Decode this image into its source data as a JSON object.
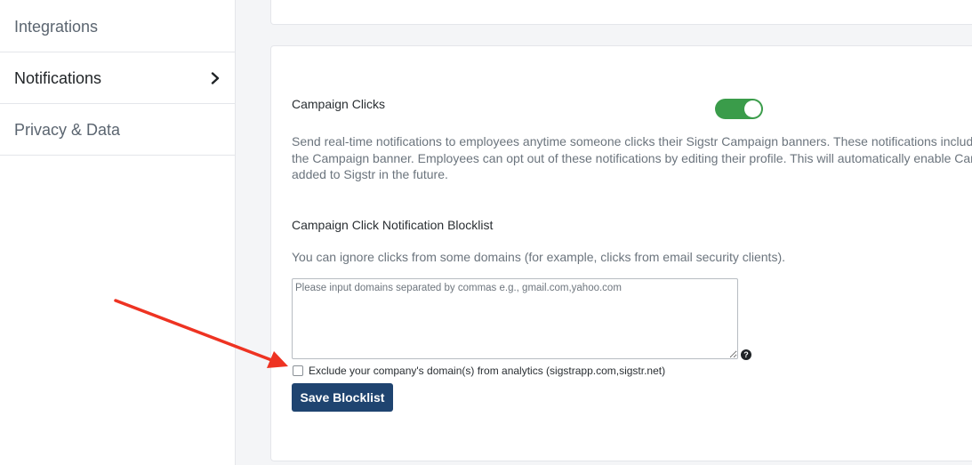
{
  "sidebar": {
    "items": [
      {
        "label": "Integrations",
        "active": false
      },
      {
        "label": "Notifications",
        "active": true
      },
      {
        "label": "Privacy & Data",
        "active": false
      }
    ]
  },
  "campaign_clicks": {
    "title": "Campaign Clicks",
    "toggle_on": true,
    "description_lines": [
      "Send real-time notifications to employees anytime someone clicks their Sigstr Campaign banners. These notifications includ",
      "the Campaign banner. Employees can opt out of these notifications by editing their profile. This will automatically enable Can",
      "added to Sigstr in the future."
    ]
  },
  "blocklist": {
    "title": "Campaign Click Notification Blocklist",
    "description": "You can ignore clicks from some domains (for example, clicks from email security clients).",
    "textarea_value": "",
    "textarea_placeholder": "Please input domains separated by commas e.g., gmail.com,yahoo.com",
    "exclude_checkbox_checked": false,
    "exclude_label": "Exclude your company's domain(s) from analytics (sigstrapp.com,sigstr.net)",
    "save_label": "Save Blocklist"
  },
  "colors": {
    "toggle_on": "#3a9c4a",
    "primary_button": "#1f4470",
    "annotation_arrow": "#ee3322"
  },
  "icons": {
    "nav_active": "chevron-right-icon",
    "help": "question-circle-icon"
  }
}
